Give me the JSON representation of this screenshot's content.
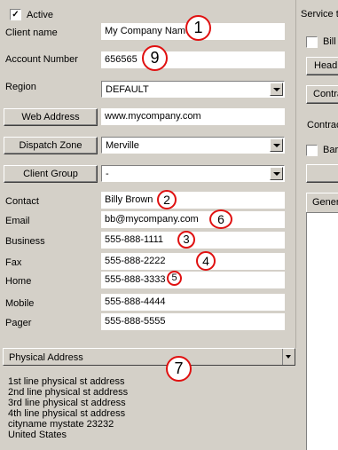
{
  "active": {
    "label": "Active",
    "checked": true
  },
  "client_name": {
    "label": "Client name",
    "value": "My Company Name"
  },
  "account_number": {
    "label": "Account Number",
    "value": "656565"
  },
  "region": {
    "label": "Region",
    "value": "DEFAULT"
  },
  "web_address": {
    "button": "Web Address",
    "value": "www.mycompany.com"
  },
  "dispatch_zone": {
    "button": "Dispatch Zone",
    "value": "Merville"
  },
  "client_group": {
    "button": "Client Group",
    "value": "-"
  },
  "contact": {
    "label": "Contact",
    "value": "Billy Brown"
  },
  "email": {
    "label": "Email",
    "value": "bb@mycompany.com"
  },
  "business": {
    "label": "Business",
    "value": "555-888-1111"
  },
  "fax": {
    "label": "Fax",
    "value": "555-888-2222"
  },
  "home": {
    "label": "Home",
    "value": "555-888-3333"
  },
  "mobile": {
    "label": "Mobile",
    "value": "555-888-4444"
  },
  "pager": {
    "label": "Pager",
    "value": "555-888-5555"
  },
  "address_selector": {
    "value": "Physical Address"
  },
  "address_lines": [
    "1st line physical st address",
    "2nd line physical st address",
    "3rd line physical st address",
    "4th line physical st address",
    "cityname mystate  23232",
    "United States"
  ],
  "right_panel": {
    "service_label": "Service t",
    "bill_label": "Bill",
    "head_button": "Head",
    "contra_button": "Contra",
    "contract_label": "Contrac",
    "bar_label": "Bar",
    "gener_tab": "Gener"
  },
  "callouts": [
    "1",
    "9",
    "2",
    "6",
    "3",
    "4",
    "5",
    "7"
  ],
  "colors": {
    "callout_border": "#e01010",
    "window_bg": "#d4d0c8"
  }
}
